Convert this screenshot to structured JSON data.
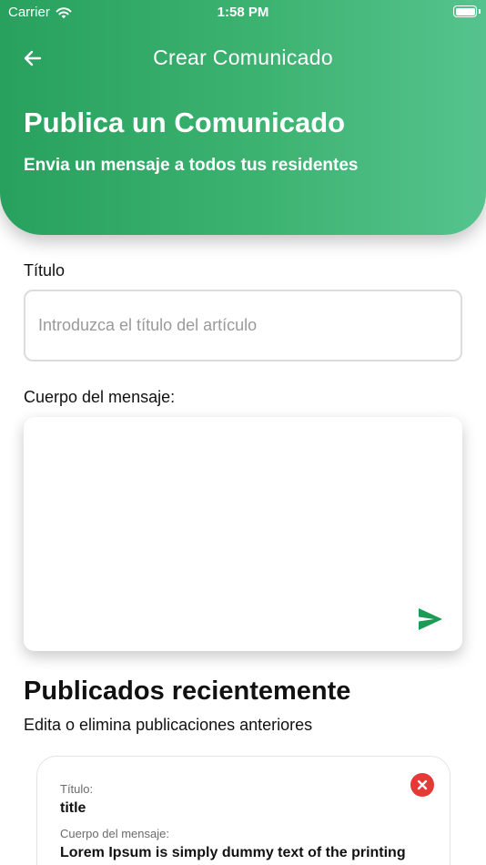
{
  "status_bar": {
    "carrier": "Carrier",
    "time": "1:58 PM"
  },
  "header": {
    "nav_title": "Crear Comunicado",
    "title": "Publica un Comunicado",
    "subtitle": "Envia un mensaje a todos tus residentes"
  },
  "form": {
    "title_label": "Título",
    "title_placeholder": "Introduzca el título del artículo",
    "title_value": "",
    "body_label": "Cuerpo del mensaje:",
    "body_value": ""
  },
  "recent": {
    "title": "Publicados recientemente",
    "subtitle": "Edita o elimina publicaciones anteriores",
    "posts": [
      {
        "title_label": "Título:",
        "title": "title",
        "body_label": "Cuerpo del mensaje:",
        "body": "Lorem Ipsum is simply dummy text of the printing"
      }
    ]
  },
  "icons": {
    "back": "arrow-left-icon",
    "send": "send-icon",
    "delete": "close-circle-icon",
    "wifi": "wifi-icon",
    "battery": "battery-icon"
  },
  "colors": {
    "primary": "#2e9e5f",
    "primary_light": "#56c38e",
    "send_icon": "#1e9a57",
    "delete": "#e53935"
  }
}
